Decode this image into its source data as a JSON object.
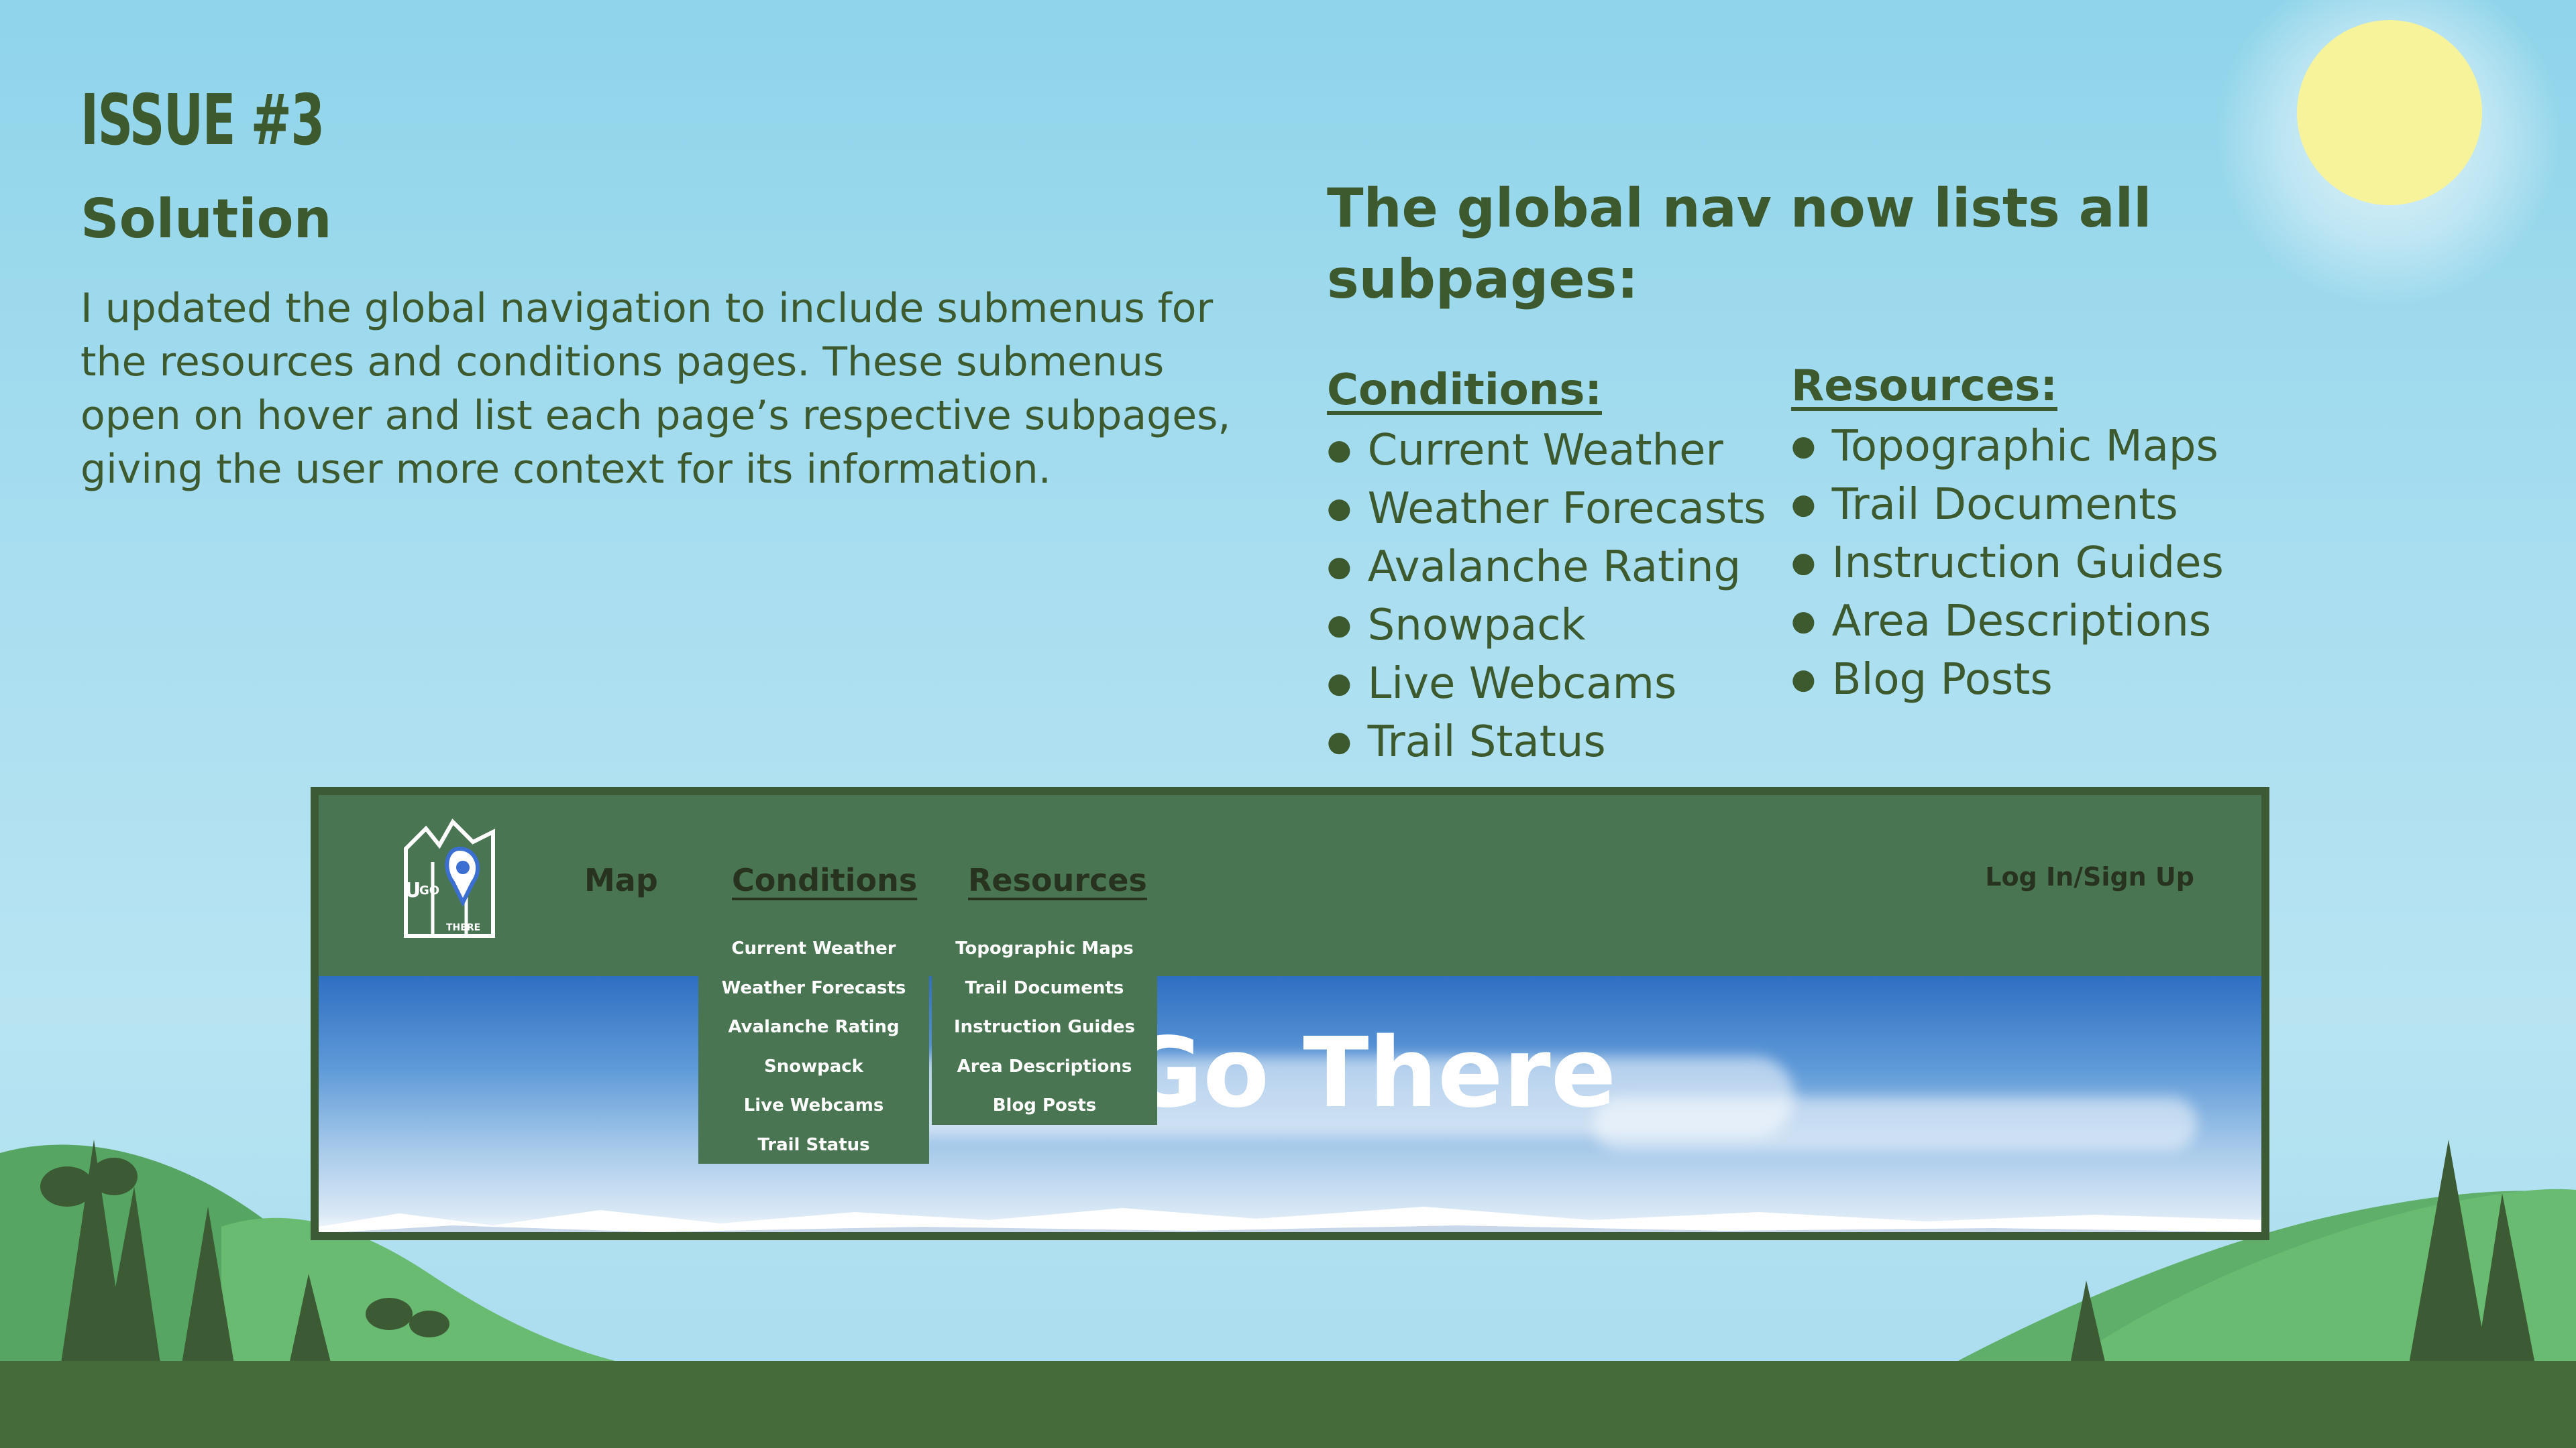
{
  "slide": {
    "issue_title": "ISSUE #3",
    "solution_heading": "Solution",
    "solution_body": "I updated the global navigation to include submenus for the resources and conditions pages. These submenus open on hover and list each page’s respective subpages, giving the user more context for its information.",
    "nav_heading": "The global nav now lists all subpages:",
    "conditions": {
      "title": "Conditions:",
      "items": [
        "Current Weather",
        "Weather Forecasts",
        "Avalanche Rating",
        "Snowpack",
        "Live Webcams",
        "Trail Status"
      ]
    },
    "resources": {
      "title": "Resources:",
      "items": [
        "Topographic Maps",
        "Trail Documents",
        "Instruction Guides",
        "Area Descriptions",
        "Blog Posts"
      ]
    }
  },
  "mockup": {
    "logo": {
      "letter_u": "U",
      "letter_go": "GO",
      "text_there": "THERE"
    },
    "nav": {
      "map": "Map",
      "conditions": "Conditions",
      "resources": "Resources",
      "login": "Log In/Sign Up"
    },
    "conditions_submenu": [
      "Current Weather",
      "Weather Forecasts",
      "Avalanche Rating",
      "Snowpack",
      "Live Webcams",
      "Trail Status"
    ],
    "resources_submenu": [
      "Topographic Maps",
      "Trail Documents",
      "Instruction Guides",
      "Area Descriptions",
      "Blog Posts"
    ],
    "hero_title": "Go There"
  },
  "colors": {
    "sky": "#a9def0",
    "text": "#3d5a2f",
    "sun": "#f7f39a",
    "nav_green": "#4a7552",
    "frame": "#3c5a34",
    "ground": "#466b3a",
    "hill": "#5fae6a",
    "tree": "#3c5a34"
  }
}
